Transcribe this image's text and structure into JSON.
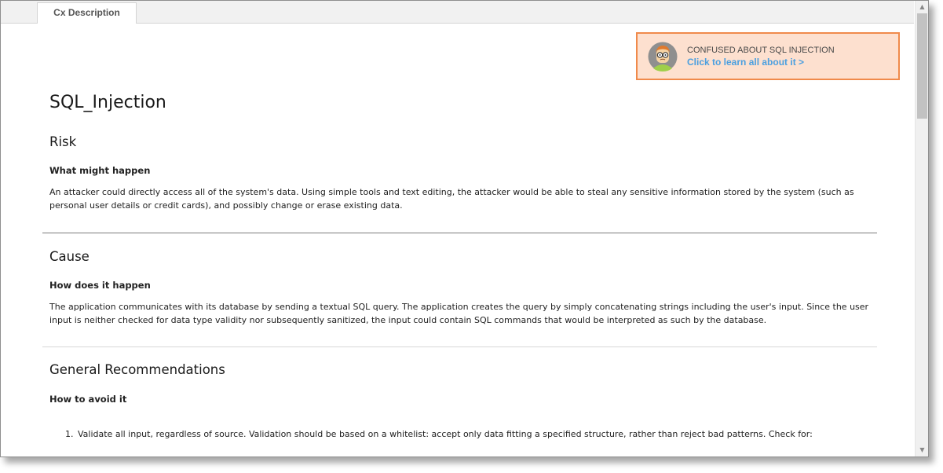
{
  "tabs": [
    {
      "label": "Cx Description",
      "active": true
    }
  ],
  "banner": {
    "icon": "developer-avatar-icon",
    "title": "CONFUSED ABOUT SQL INJECTION",
    "link_text": "Click to learn all about it >",
    "border_color": "#f08a4b",
    "background_color": "#fde0cf",
    "link_color": "#4a9fe0"
  },
  "page_title": "SQL_Injection",
  "sections": {
    "risk": {
      "heading": "Risk",
      "subheading": "What might happen",
      "text": "An attacker could directly access all of the system's data. Using simple tools and text editing, the attacker would be able to steal any sensitive information stored by the system (such as personal user details or credit cards), and possibly change or erase existing data."
    },
    "cause": {
      "heading": "Cause",
      "subheading": "How does it happen",
      "text": "The application communicates with its database by sending a textual SQL query. The application creates the query by simply concatenating strings including the user's input. Since the user input is neither checked for data type validity nor subsequently sanitized, the input could contain SQL commands that would be interpreted as such by the database."
    },
    "recommendations": {
      "heading": "General Recommendations",
      "subheading": "How to avoid it",
      "items": [
        {
          "number": "1.",
          "text": "Validate all input, regardless of source. Validation should be based on a whitelist: accept only data fitting a specified structure, rather than reject bad patterns. Check for:"
        }
      ]
    }
  },
  "scrollbar": {
    "up_icon": "▲",
    "down_icon": "▼"
  }
}
